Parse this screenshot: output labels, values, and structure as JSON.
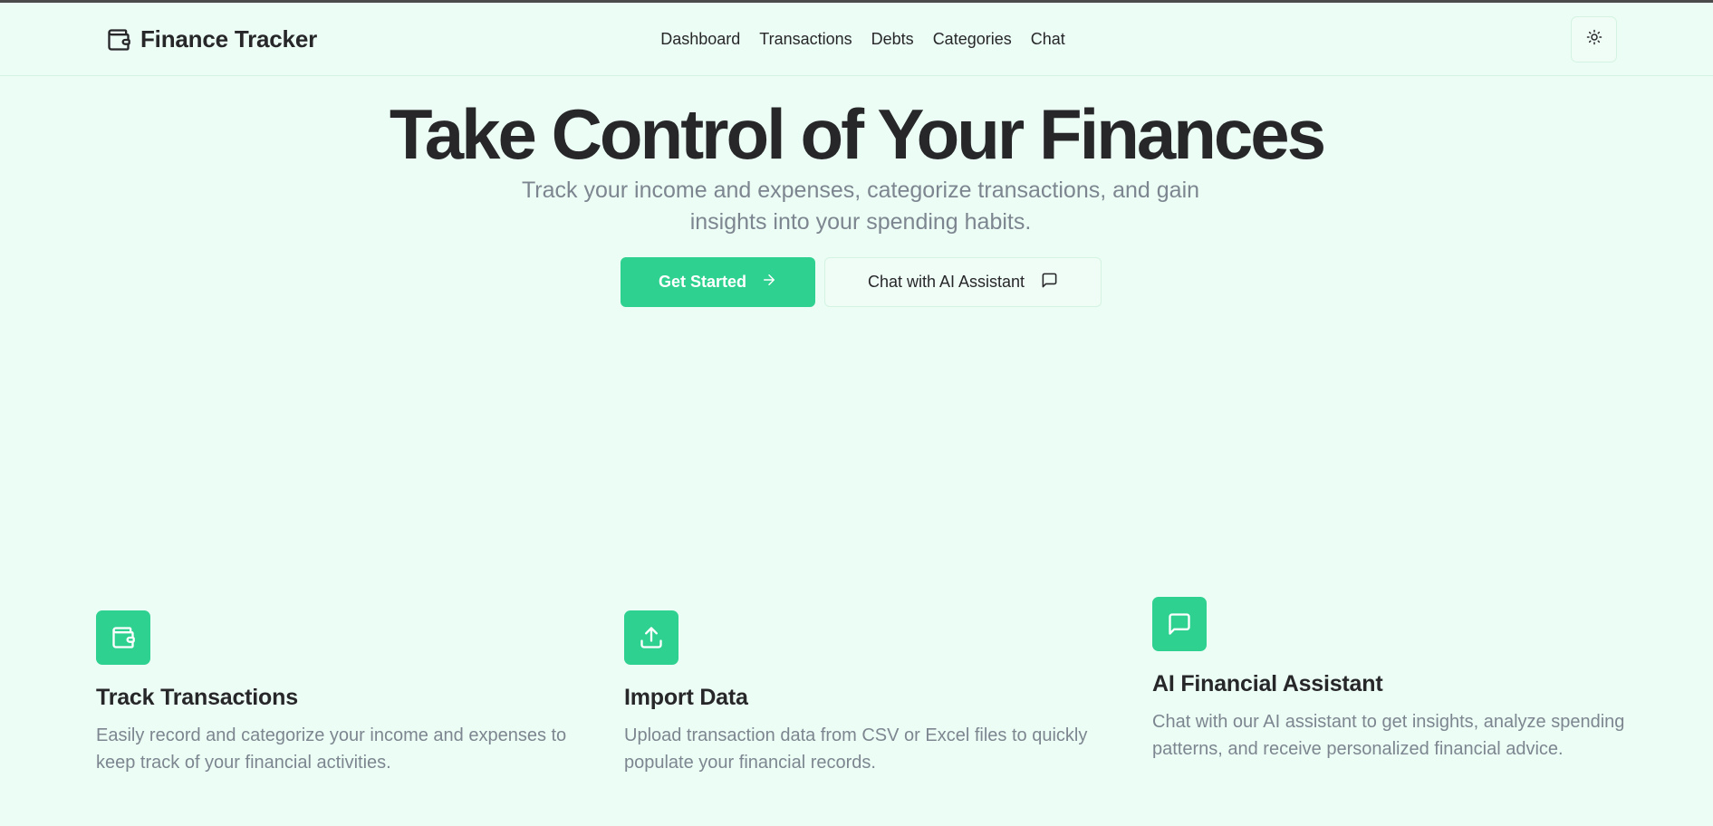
{
  "header": {
    "brand": "Finance Tracker",
    "brand_icon": "wallet-icon",
    "nav": [
      "Dashboard",
      "Transactions",
      "Debts",
      "Categories",
      "Chat"
    ],
    "theme_icon": "sun-icon"
  },
  "hero": {
    "title": "Take Control of Your Finances",
    "subtitle": "Track your income and expenses, categorize transactions, and gain insights into your spending habits.",
    "primary_button": "Get Started",
    "primary_icon": "arrow-right-icon",
    "secondary_button": "Chat with AI Assistant",
    "secondary_icon": "message-square-icon"
  },
  "features": [
    {
      "icon": "wallet-icon",
      "title": "Track Transactions",
      "description": "Easily record and categorize your income and expenses to keep track of your financial activities."
    },
    {
      "icon": "upload-icon",
      "title": "Import Data",
      "description": "Upload transaction data from CSV or Excel files to quickly populate your financial records."
    },
    {
      "icon": "message-square-icon",
      "title": "AI Financial Assistant",
      "description": "Chat with our AI assistant to get insights, analyze spending patterns, and receive personalized financial advice."
    }
  ],
  "colors": {
    "background": "#ebfdf4",
    "accent": "#2ed190",
    "text": "#27272a",
    "muted_text": "#7d8690"
  }
}
